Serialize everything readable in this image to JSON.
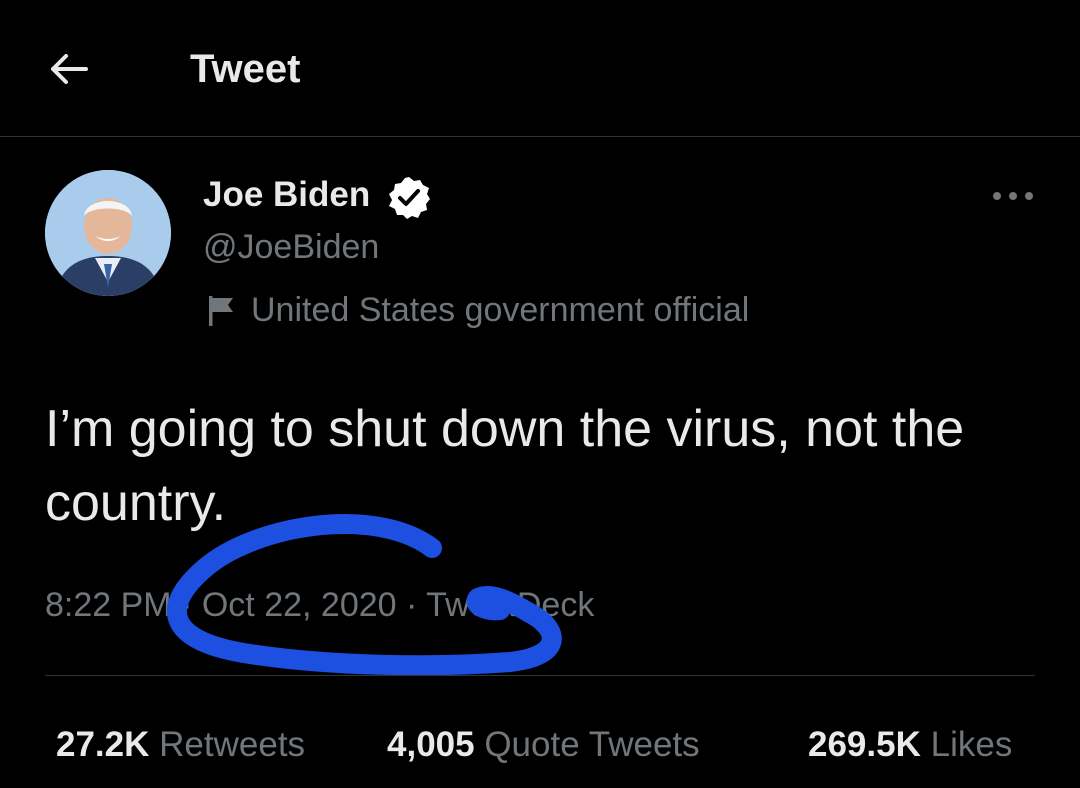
{
  "header": {
    "title": "Tweet",
    "back_icon": "arrow-left-icon"
  },
  "author": {
    "name": "Joe Biden",
    "handle": "@JoeBiden",
    "verified_icon": "verified-badge-icon",
    "label_icon": "flag-icon",
    "label": "United States government official"
  },
  "more_icon": "more-horizontal-icon",
  "tweet": {
    "text": "I’m going to shut down the virus, not the country."
  },
  "meta": {
    "time": "8:22 PM",
    "separator": "·",
    "date": "Oct 22, 2020",
    "source": "TweetDeck"
  },
  "stats": {
    "retweets_count": "27.2K",
    "retweets_label": "Retweets",
    "quotes_count": "4,005",
    "quotes_label": "Quote Tweets",
    "likes_count": "269.5K",
    "likes_label": "Likes"
  },
  "colors": {
    "background": "#000000",
    "text": "#e7e9ea",
    "secondary": "#71767b",
    "verified": "#ffffff",
    "scribble": "#1d4fe0"
  }
}
